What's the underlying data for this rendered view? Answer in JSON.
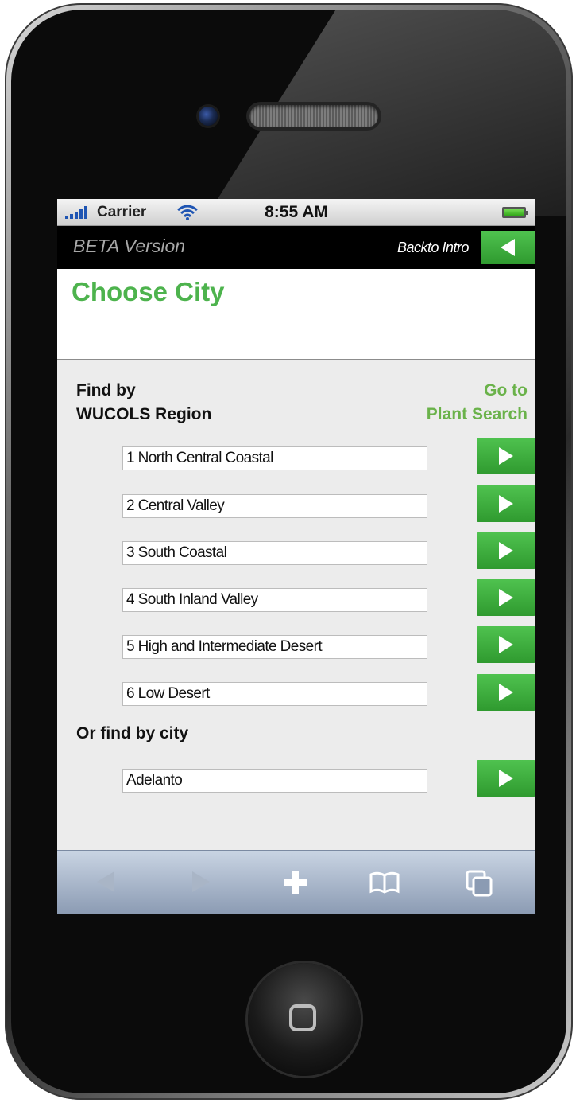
{
  "status_bar": {
    "carrier": "Carrier",
    "time": "8:55 AM"
  },
  "header": {
    "beta_label": "BETA Version",
    "back_link": "Backto Intro"
  },
  "page_title": "Choose City",
  "find_by": {
    "line1": "Find by",
    "line2": "WUCOLS Region"
  },
  "goto": {
    "line1": "Go to",
    "line2": "Plant Search"
  },
  "regions": [
    "1 North Central Coastal",
    "2 Central Valley",
    "3 South Coastal",
    "4 South Inland Valley",
    "5 High and Intermediate Desert",
    "6 Low Desert"
  ],
  "city_section": {
    "label": "Or find by city",
    "selected_city": "Adelanto"
  },
  "toolbar": {
    "icons": [
      "back-arrow-icon",
      "forward-arrow-icon",
      "plus-icon",
      "bookmarks-icon",
      "pages-icon"
    ]
  },
  "colors": {
    "accent_green": "#4db34d",
    "header_black": "#000000",
    "screen_bg": "#ececec"
  }
}
